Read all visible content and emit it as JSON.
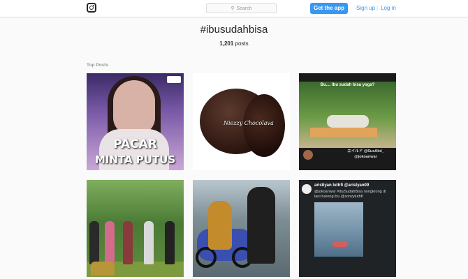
{
  "header": {
    "search_placeholder": "Search",
    "get_app": "Get the app",
    "signup": "Sign up",
    "separator": "|",
    "login": "Log in"
  },
  "hashtag": "#ibusudahbisa",
  "post_count": "1,201",
  "post_count_label": "posts",
  "section_label": "Top Posts",
  "posts": [
    {
      "caption_line1": "PACAR",
      "caption_line2": "MINTA PUTUS"
    },
    {
      "caption": "Niezzy Chocolava"
    },
    {
      "caption": "Bu.... Ibu sudah bisa yoga?",
      "user": "エイルド @SusAkd_",
      "handle": "@jokoanwar"
    },
    {},
    {},
    {
      "name": "aristiyan luthfi @aristyan09",
      "text": "@jokoanwar #ibuSudahBisa nongkrong di laut bareng ibu @sonzyiuthfl"
    }
  ],
  "colors": {
    "accent": "#3897f0",
    "text": "#262626",
    "muted": "#999999"
  }
}
